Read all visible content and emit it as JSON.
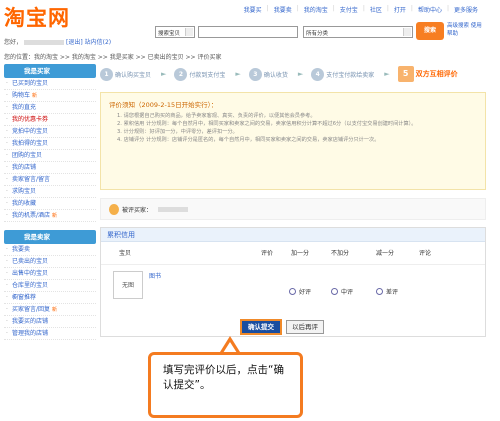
{
  "header": {
    "logo": "淘宝网",
    "toplinks": [
      "我要买",
      "我要卖",
      "我的淘宝",
      "支付宝",
      "社区",
      "打开",
      "帮助中心",
      "更多服务"
    ],
    "greeting_prefix": "您好，",
    "logout": "[退出]",
    "inbox": "站内信(2)"
  },
  "search": {
    "type": "搜索宝贝",
    "category": "所有分类",
    "button": "搜索",
    "advanced": "高级搜索 使用帮助"
  },
  "breadcrumb": {
    "items": [
      "您的位置：",
      "我的淘宝",
      "我的淘宝",
      "我是买家",
      "已卖出的宝贝",
      "评价买家"
    ],
    "text": "您的位置：我的淘宝 >> 我的淘宝 >> 我是买家 >> 已卖出的宝贝 >> 评价买家"
  },
  "sidebar": {
    "section1": "我是买家",
    "items1": [
      {
        "label": "已买到的宝贝",
        "new": ""
      },
      {
        "label": "购物车",
        "new": "新"
      },
      {
        "label": "我的直充",
        "new": ""
      },
      {
        "label": "我的优惠卡券",
        "new": ""
      },
      {
        "label": "竞拍中的宝贝",
        "new": ""
      },
      {
        "label": "我拍得的宝贝",
        "new": ""
      },
      {
        "label": "团购的宝贝",
        "new": ""
      },
      {
        "label": "我的店铺",
        "new": ""
      },
      {
        "label": "卖家留言/留言",
        "new": ""
      },
      {
        "label": "求购宝贝",
        "new": ""
      },
      {
        "label": "我的收藏",
        "new": ""
      },
      {
        "label": "我的机票/酒店",
        "new": "新"
      }
    ],
    "section2": "我是卖家",
    "items2": [
      {
        "label": "我要卖",
        "new": ""
      },
      {
        "label": "已卖出的宝贝",
        "new": ""
      },
      {
        "label": "出售中的宝贝",
        "new": ""
      },
      {
        "label": "仓库里的宝贝",
        "new": ""
      },
      {
        "label": "橱窗推荐",
        "new": ""
      },
      {
        "label": "买家留言/回复",
        "new": "新"
      },
      {
        "label": "我要买的店铺",
        "new": ""
      },
      {
        "label": "管理我的店铺",
        "new": ""
      }
    ]
  },
  "steps": [
    {
      "num": "1",
      "label": "确认购买宝贝",
      "current": false
    },
    {
      "num": "2",
      "label": "付款到支付宝",
      "current": false
    },
    {
      "num": "3",
      "label": "确认收货",
      "current": false
    },
    {
      "num": "4",
      "label": "支付宝付款给卖家",
      "current": false
    },
    {
      "num": "5",
      "label": "双方互相评价",
      "current": true
    }
  ],
  "notice": {
    "title": "评价须知（2009-2-15日开始实行）：",
    "lines": [
      "1. 请您根据自己购买的商品，给予卖家客观、真实、负责的评价，以便其他会员参考。",
      "2. 累积信用 计分规则：每个自然月中，相同买家和卖家之间的交易，卖家信用积分计算不超过6分（以支付宝交易创建时间计算）。",
      "3. 计分规则：好评加一分，中评零分，差评扣一分。",
      "",
      "4. 店铺评分 计分规则：店铺评分是匿名的，每个自然月中，相同买家和卖家之间的交易，卖家店铺评分只计一次。"
    ]
  },
  "rated": {
    "label": "被评买家："
  },
  "credit": {
    "title": "累积信用",
    "columns": [
      "宝贝",
      "评价",
      "加一分",
      "不加分",
      "减一分",
      "评论"
    ],
    "item": {
      "thumb": "无图",
      "name": "图书"
    },
    "options": [
      "好评",
      "中评",
      "差评"
    ]
  },
  "buttons": {
    "confirm": "确认提交",
    "later": "以后再评"
  },
  "tip": {
    "text": "填写完评价以后，点击“确认提交”。"
  }
}
